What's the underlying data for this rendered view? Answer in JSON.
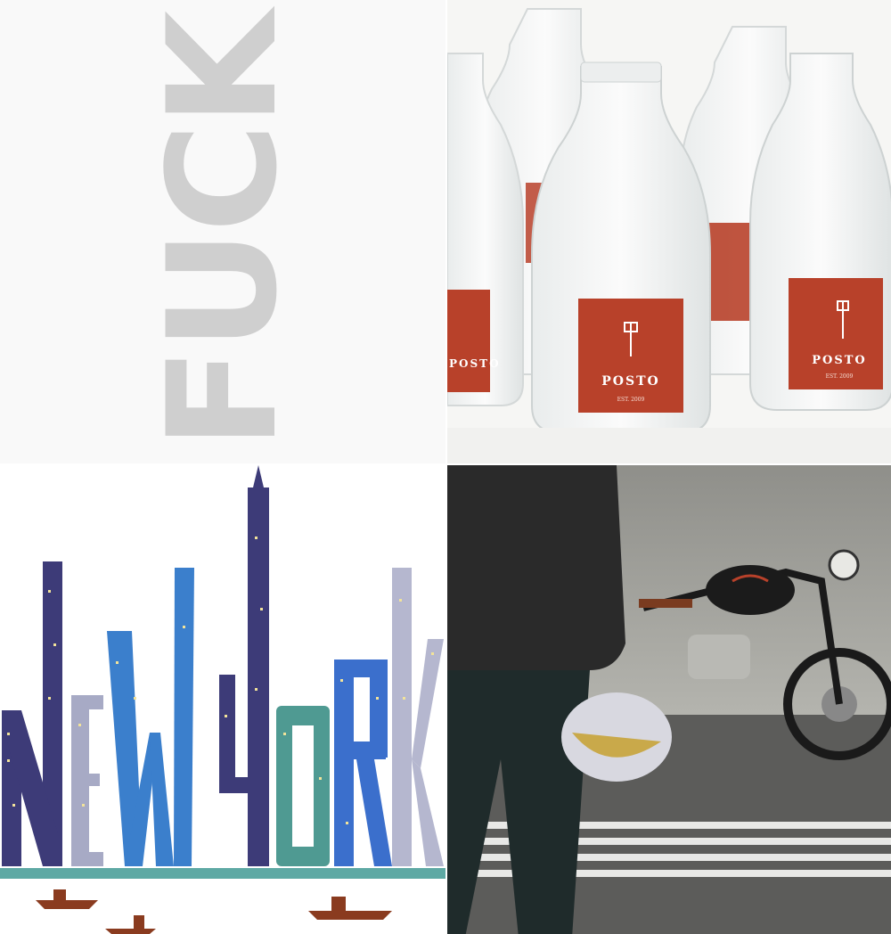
{
  "tile_typography": {
    "word": "FUCK",
    "color": "#cfcfcf"
  },
  "tile_bottles": {
    "label_brand": "POSTO",
    "label_est": "EST. 2009",
    "label_color": "#b8412a",
    "icon": "shovel-fork-icon"
  },
  "tile_new_york": {
    "letters": [
      "N",
      "E",
      "W",
      "Y",
      "O",
      "R",
      "K"
    ],
    "water_color": "#5ea9a4"
  },
  "tile_motorcycle": {
    "icon": "motorcycle-photo"
  }
}
